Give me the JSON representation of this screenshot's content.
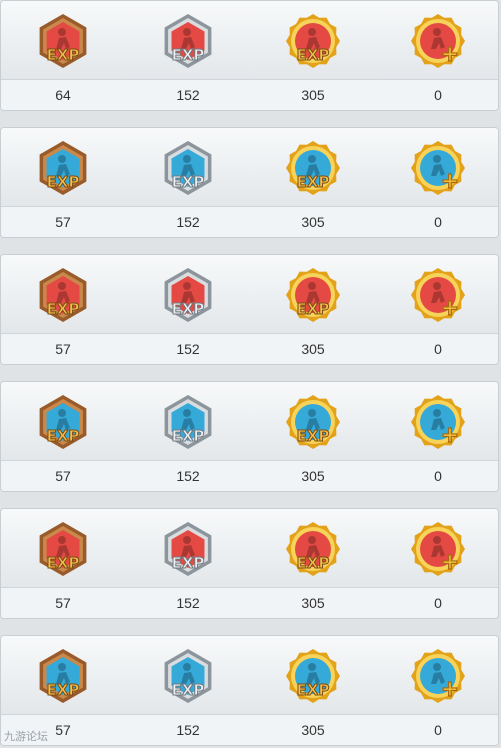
{
  "rows": [
    {
      "theme": "red",
      "values": [
        "64",
        "152",
        "305",
        "0"
      ]
    },
    {
      "theme": "blue",
      "values": [
        "57",
        "152",
        "305",
        "0"
      ]
    },
    {
      "theme": "red",
      "values": [
        "57",
        "152",
        "305",
        "0"
      ]
    },
    {
      "theme": "blue",
      "values": [
        "57",
        "152",
        "305",
        "0"
      ]
    },
    {
      "theme": "red",
      "values": [
        "57",
        "152",
        "305",
        "0"
      ]
    },
    {
      "theme": "blue",
      "values": [
        "57",
        "152",
        "305",
        "0"
      ]
    }
  ],
  "badges": [
    {
      "icon": "bronze-exp-badge-icon",
      "label": "EXP",
      "frame": "#9a5b2a",
      "rim": "#c9894c",
      "shape": "hex"
    },
    {
      "icon": "silver-exp-badge-icon",
      "label": "EXP",
      "frame": "#8d959c",
      "rim": "#d9dde0",
      "shape": "hex"
    },
    {
      "icon": "gold-exp-badge-icon",
      "label": "EXP",
      "frame": "#e2a21a",
      "rim": "#f7d35a",
      "shape": "gear"
    },
    {
      "icon": "gold-plus-badge-icon",
      "label": "+",
      "frame": "#e2a21a",
      "rim": "#f7d35a",
      "shape": "gear"
    }
  ],
  "colors": {
    "red": "#e44a43",
    "blue": "#35a9d8"
  },
  "watermark": "九游论坛"
}
